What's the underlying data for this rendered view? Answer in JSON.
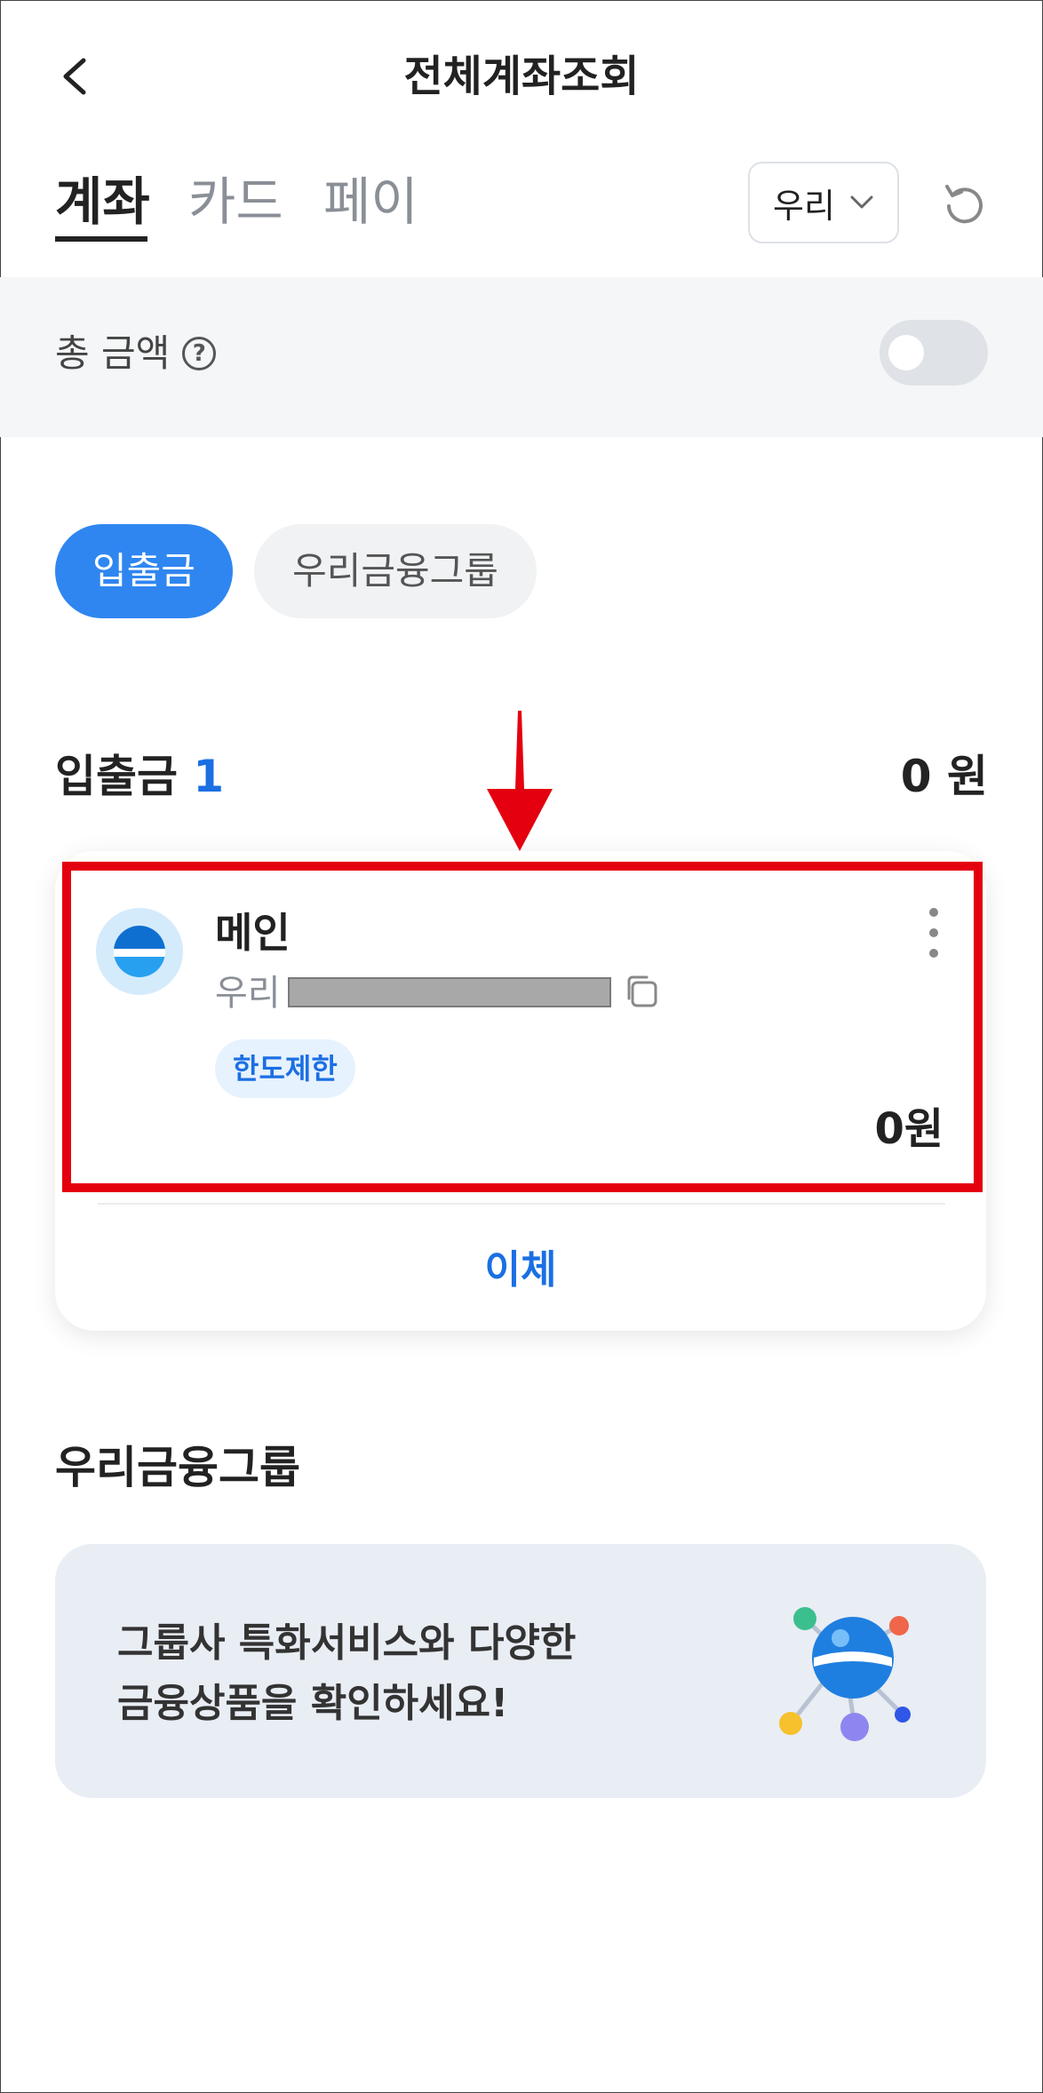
{
  "header": {
    "title": "전체계좌조회"
  },
  "tabs": [
    {
      "label": "계좌",
      "active": true
    },
    {
      "label": "카드",
      "active": false
    },
    {
      "label": "페이",
      "active": false
    }
  ],
  "bank_filter": {
    "selected": "우리"
  },
  "total": {
    "label": "총 금액",
    "help_icon": "question-circle-icon",
    "toggle_on": false
  },
  "chips": [
    {
      "label": "입출금",
      "active": true
    },
    {
      "label": "우리금융그룹",
      "active": false
    }
  ],
  "deposit_section": {
    "title": "입출금",
    "count": "1",
    "amount": "0 원"
  },
  "account": {
    "name": "메인",
    "bank": "우리",
    "badge": "한도제한",
    "balance": "0원",
    "transfer_label": "이체"
  },
  "group_section": {
    "title": "우리금융그룹",
    "banner_line1": "그룹사 특화서비스와 다양한",
    "banner_line2": "금융상품을 확인하세요!"
  },
  "colors": {
    "accent": "#2f86f0",
    "link_blue": "#1b6fe3",
    "highlight_red": "#e4000f",
    "band_bg": "#f5f6f8",
    "banner_bg": "#e9edf4"
  }
}
